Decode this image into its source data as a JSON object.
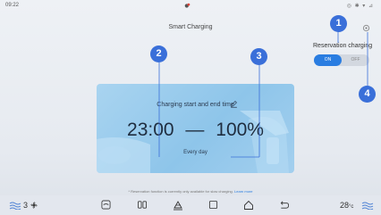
{
  "status_bar": {
    "time": "09:22",
    "icons": "◎ ✱ ▾ ⊿"
  },
  "page": {
    "title": "Smart Charging"
  },
  "reservation": {
    "label": "Reservation charging",
    "on_label": "ON",
    "off_label": "OFF",
    "state": "ON"
  },
  "card": {
    "title": "Charging start and end time",
    "time": "23:00",
    "separator": "—",
    "percent": "100%",
    "repeat": "Every day"
  },
  "notice": {
    "text": "* Reservation function is currently only available for slow charging.",
    "link": "Learn more"
  },
  "bottom_bar": {
    "left_temp": "3",
    "right_temp": "28",
    "right_unit": "°c"
  },
  "callouts": [
    "1",
    "2",
    "3",
    "4"
  ],
  "colors": {
    "accent": "#2a7de1",
    "callout": "#3a6fd9"
  }
}
